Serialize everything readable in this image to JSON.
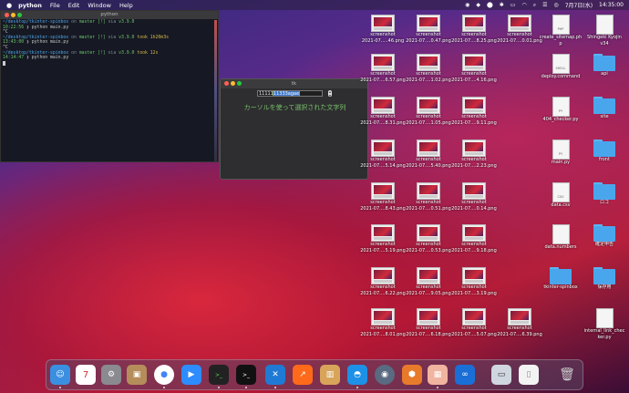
{
  "menubar": {
    "apple": "",
    "app_name": "python",
    "items": [
      "File",
      "Edit",
      "Window",
      "Help"
    ],
    "date": "7月7日(水)",
    "time": "14:35:00"
  },
  "terminal": {
    "title": "python",
    "lines": [
      {
        "path": "~/desktop/tkinter-spinbox",
        "on": "on",
        "branch": "master [!]",
        "via": "via",
        "ver": "v3.9.0",
        "extra": ""
      },
      {
        "time": "10:22:56",
        "cmd": "python main.py"
      },
      {
        "text": "^C"
      },
      {
        "path": "~/desktop/tkinter-spinbox",
        "on": "on",
        "branch": "master [!]",
        "via": "via",
        "ver": "v3.9.0",
        "extra": "took 1h20m3s"
      },
      {
        "time": "13:43:00",
        "cmd": "python main.py"
      },
      {
        "text": "^C"
      },
      {
        "path": "~/desktop/tkinter-spinbox",
        "on": "on",
        "branch": "master [!]",
        "via": "via",
        "ver": "v3.9.0",
        "extra": "took 12s"
      },
      {
        "time": "14:14:47",
        "cmd": "python main.py"
      }
    ]
  },
  "tk": {
    "title": "tk",
    "entry_plain": "11111",
    "entry_selected": "11333agae",
    "label": "カーソルを使って選択された文字列"
  },
  "desktop": {
    "col1": [
      {
        "l1": "screenshot",
        "l2": "2021-07.....46.png"
      },
      {
        "l1": "screenshot",
        "l2": "2021-07....6.57.png"
      },
      {
        "l1": "screenshot",
        "l2": "2021-07....8.31.png"
      },
      {
        "l1": "screenshot",
        "l2": "2021-07....5.14.png"
      },
      {
        "l1": "screenshot",
        "l2": "2021-07....8.43.png"
      },
      {
        "l1": "screenshot",
        "l2": "2021-07....5.19.png"
      },
      {
        "l1": "screenshot",
        "l2": "2021-07....6.22.png"
      },
      {
        "l1": "screenshot",
        "l2": "2021-07....8.01.png"
      }
    ],
    "col2": [
      {
        "l1": "screenshot",
        "l2": "2021-07....0.47.png"
      },
      {
        "l1": "screenshot",
        "l2": "2021-07....1.02.png"
      },
      {
        "l1": "screenshot",
        "l2": "2021-07....1.05.png"
      },
      {
        "l1": "screenshot",
        "l2": "2021-07....5.40.png"
      },
      {
        "l1": "screenshot",
        "l2": "2021-07....0.51.png"
      },
      {
        "l1": "screenshot",
        "l2": "2021-07....0.53.png"
      },
      {
        "l1": "screenshot",
        "l2": "2021-07....9.05.png"
      },
      {
        "l1": "screenshot",
        "l2": "2021-07....6.18.png"
      }
    ],
    "col3": [
      {
        "l1": "screenshot",
        "l2": "2021-07....8.25.png"
      },
      {
        "l1": "screenshot",
        "l2": "2021-07....4.16.png"
      },
      {
        "l1": "screenshot",
        "l2": "2021-07....9.11.png"
      },
      {
        "l1": "screenshot",
        "l2": "2021-07....2.23.png"
      },
      {
        "l1": "screenshot",
        "l2": "2021-07....0.14.png"
      },
      {
        "l1": "screenshot",
        "l2": "2021-07....9.18.png"
      },
      {
        "l1": "screenshot",
        "l2": "2021-07....3.19.png"
      },
      {
        "l1": "screenshot",
        "l2": "2021-07....5.07.png"
      }
    ],
    "col4": [
      {
        "l1": "screenshot",
        "l2": "2021-07....0.01.png"
      },
      {
        "l1": "deploy.command",
        "l2": ""
      },
      {
        "l1": "404_checker.py",
        "l2": ""
      },
      {
        "l1": "main.py",
        "l2": ""
      },
      {
        "l1": "data.csv",
        "l2": ""
      },
      {
        "l1": "data.numbers",
        "l2": ""
      },
      {
        "l1": "tkinter-spinbox",
        "l2": ""
      },
      {
        "l1": "screenshot",
        "l2": "2021-07....6.39.png"
      }
    ],
    "col4_top": {
      "l1": "create_sitemap.ph",
      "l2": "p"
    },
    "col5": [
      {
        "l1": "Shingeki Kyojin",
        "l2": "v34"
      },
      {
        "l1": "api",
        "l2": ""
      },
      {
        "l1": "site",
        "l2": ""
      },
      {
        "l1": "front",
        "l2": ""
      },
      {
        "l1": "ロゴ",
        "l2": ""
      },
      {
        "l1": "確定申告",
        "l2": ""
      },
      {
        "l1": "保存用",
        "l2": ""
      },
      {
        "l1": "internal_link_chec",
        "l2": "ker.py"
      }
    ],
    "doc_tags": {
      "shell": "SHELL",
      "py": "PY",
      "csv": "CSV",
      "php": "PHP"
    }
  },
  "dock": {
    "items": [
      "finder",
      "calendar",
      "system-preferences",
      "contacts",
      "chrome",
      "zoom",
      "terminal-a",
      "terminal-b",
      "vscode",
      "grapher",
      "archive",
      "docker",
      "quicktime",
      "sourcetree",
      "preview",
      "infinity",
      "screenshot-app",
      "document",
      "trash"
    ],
    "calendar_day": "7"
  }
}
